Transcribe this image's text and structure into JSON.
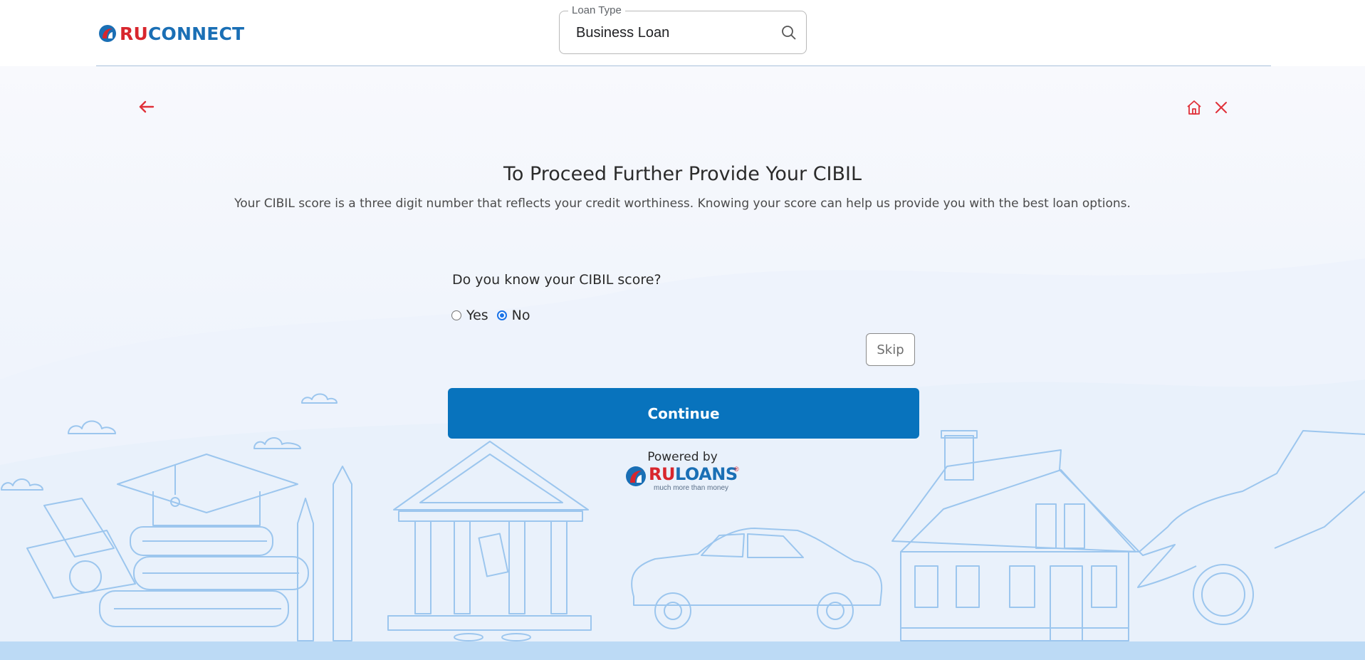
{
  "header": {
    "logo": {
      "ru": "RU",
      "rest": "CONNECT"
    },
    "loan_type": {
      "legend": "Loan Type",
      "value": "Business Loan"
    }
  },
  "page": {
    "title": "To Proceed Further Provide Your CIBIL",
    "subtitle": "Your CIBIL score is a three digit number that reflects your credit worthiness. Knowing your score can help us provide you with the best loan options."
  },
  "form": {
    "question": "Do you know your CIBIL score?",
    "options": [
      {
        "label": "Yes",
        "selected": false
      },
      {
        "label": "No",
        "selected": true
      }
    ],
    "skip_label": "Skip",
    "continue_label": "Continue"
  },
  "footer": {
    "powered_by": "Powered by",
    "brand_ru": "RU",
    "brand_rest": "LOANS",
    "registered": "®",
    "tagline": "much more than money"
  },
  "colors": {
    "accent": "#0873bd",
    "brand_red": "#d8262d",
    "brand_blue": "#1a6fb5",
    "icon_red": "#e0313a",
    "illustration": "#9cc6ee"
  },
  "icons": {
    "back": "arrow-left-icon",
    "home": "home-icon",
    "close": "close-icon",
    "search": "search-icon"
  }
}
